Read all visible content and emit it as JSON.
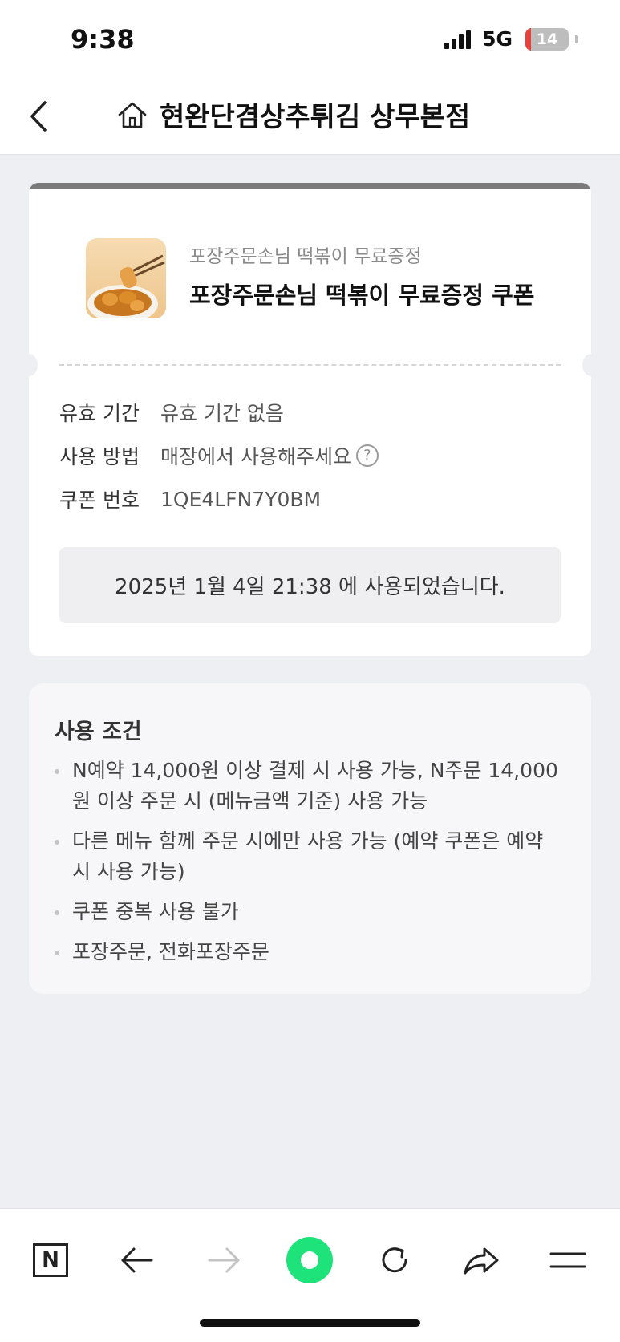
{
  "status_bar": {
    "time": "9:38",
    "network": "5G",
    "battery_level": "14"
  },
  "header": {
    "back_icon": "chevron-left-icon",
    "home_icon": "home-icon",
    "title": "현완단겸상추튀김 상무본점"
  },
  "coupon": {
    "subtitle": "포장주문손님 떡볶이 무료증정",
    "name": "포장주문손님 떡볶이 무료증정 쿠폰",
    "details": [
      {
        "label": "유효 기간",
        "value": "유효 기간 없음"
      },
      {
        "label": "사용 방법",
        "value": "매장에서 사용해주세요"
      },
      {
        "label": "쿠폰 번호",
        "value": "1QE4LFN7Y0BM"
      }
    ],
    "used_message": "2025년 1월 4일 21:38 에 사용되었습니다."
  },
  "conditions": {
    "title": "사용 조건",
    "items": [
      "N예약 14,000원 이상 결제 시 사용 가능, N주문 14,000원 이상 주문 시 (메뉴금액 기준) 사용 가능",
      "다른 메뉴 함께 주문 시에만 사용 가능 (예약 쿠폰은 예약시 사용 가능)",
      "쿠폰 중복 사용 불가",
      "포장주문, 전화포장주문"
    ]
  },
  "bottom_nav": {
    "logo_letter": "N",
    "colors": {
      "accent_green": "#1ee37a",
      "battery_red": "#e8413a"
    }
  }
}
